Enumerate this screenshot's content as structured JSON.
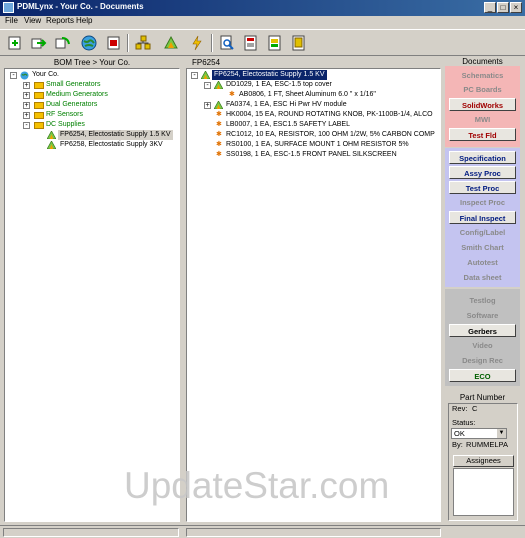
{
  "window": {
    "title": "PDMLynx - Your Co. - Documents",
    "controls": [
      "minimize",
      "maximize",
      "close"
    ]
  },
  "menu": [
    "File",
    "View",
    "Reports",
    "Help"
  ],
  "toolbar": {
    "icons": [
      "new-item-icon",
      "forward-icon",
      "refresh-icon",
      "globe-icon",
      "delete-icon",
      "bom-icon",
      "tree-icon",
      "lightning-icon",
      "search-icon",
      "report-icon",
      "export-icon",
      "print-icon"
    ]
  },
  "left_panel": {
    "header": "BOM Tree > Your Co.",
    "tree": [
      {
        "label": "Your Co.",
        "level": 0,
        "toggle": "-",
        "icon": "globe-icon"
      },
      {
        "label": "Small Generators",
        "level": 1,
        "toggle": "+",
        "icon": "folder-icon"
      },
      {
        "label": "Medium Generators",
        "level": 1,
        "toggle": "+",
        "icon": "folder-icon"
      },
      {
        "label": "Dual Generators",
        "level": 1,
        "toggle": "+",
        "icon": "folder-icon"
      },
      {
        "label": "RF Sensors",
        "level": 1,
        "toggle": "+",
        "icon": "folder-icon"
      },
      {
        "label": "DC Supplies",
        "level": 1,
        "toggle": "-",
        "icon": "folder-icon"
      },
      {
        "label": "FP6254, Electostatic Supply 1.5 KV",
        "level": 2,
        "toggle": "",
        "icon": "assembly-icon"
      },
      {
        "label": "FP6258, Electostatic Supply  3KV",
        "level": 2,
        "toggle": "",
        "icon": "assembly-icon"
      }
    ]
  },
  "center_panel": {
    "header": "FP6254",
    "tree": [
      {
        "label": "FP6254, Electostatic Supply 1.5 KV",
        "level": 0,
        "toggle": "-",
        "icon": "assembly-icon"
      },
      {
        "label": "DD1029, 1 EA, ESC-1.5 top cover",
        "level": 1,
        "toggle": "-",
        "icon": "assembly-icon"
      },
      {
        "label": "AB0806, 1 FT, Sheet Aluminum   6.0 \" x 1/16\"",
        "level": 2,
        "toggle": "",
        "icon": "part-icon"
      },
      {
        "label": "FA0374, 1 EA, ESC Hi Pwr HV module",
        "level": 1,
        "toggle": "+",
        "icon": "assembly-icon"
      },
      {
        "label": "HK0004, 15 EA, ROUND ROTATING KNOB, PK-1100B-1/4, ALCO",
        "level": 1,
        "toggle": "",
        "icon": "part-icon"
      },
      {
        "label": "LB0007, 1 EA, ESC1.5 SAFETY LABEL",
        "level": 1,
        "toggle": "",
        "icon": "part-icon"
      },
      {
        "label": "RC1012, 10 EA, RESISTOR, 100 OHM 1/2W, 5% CARBON COMP",
        "level": 1,
        "toggle": "",
        "icon": "part-icon"
      },
      {
        "label": "RS0100, 1 EA, SURFACE MOUNT 1 OHM RESISTOR 5%",
        "level": 1,
        "toggle": "",
        "icon": "part-icon"
      },
      {
        "label": "SS0198, 1 EA, ESC-1.5 FRONT PANEL SILKSCREEN",
        "level": 1,
        "toggle": "",
        "icon": "part-icon"
      }
    ]
  },
  "documents": {
    "header": "Documents",
    "buttons": [
      {
        "label": "Schematics",
        "state": "dim",
        "group": "red"
      },
      {
        "label": "PC Boards",
        "state": "dim",
        "group": "red"
      },
      {
        "label": "SolidWorks",
        "state": "boxed",
        "group": "red"
      },
      {
        "label": "MWI",
        "state": "dim",
        "group": "red"
      },
      {
        "label": "Test Fld",
        "state": "boxed",
        "group": "red"
      },
      {
        "label": "Specification",
        "state": "boxed",
        "group": "blue"
      },
      {
        "label": "Assy Proc",
        "state": "boxed",
        "group": "blue"
      },
      {
        "label": "Test Proc",
        "state": "boxed",
        "group": "blue"
      },
      {
        "label": "Inspect Proc",
        "state": "dim",
        "group": "blue"
      },
      {
        "label": "Final Inspect",
        "state": "boxed",
        "group": "blue"
      },
      {
        "label": "Config/Label",
        "state": "dim",
        "group": "blue"
      },
      {
        "label": "Smith Chart",
        "state": "dim",
        "group": "blue"
      },
      {
        "label": "Autotest",
        "state": "dim",
        "group": "blue"
      },
      {
        "label": "Data sheet",
        "state": "dim",
        "group": "blue"
      },
      {
        "label": "Testlog",
        "state": "dim",
        "group": "grey"
      },
      {
        "label": "Software",
        "state": "dim",
        "group": "grey"
      },
      {
        "label": "Gerbers",
        "state": "boxed",
        "group": "grey"
      },
      {
        "label": "Video",
        "state": "dim",
        "group": "grey"
      },
      {
        "label": "Design Rec",
        "state": "dim",
        "group": "grey"
      },
      {
        "label": "ECO",
        "state": "boxed",
        "group": "grey"
      }
    ],
    "colors": {
      "red_band": "#f4b6b6",
      "blue_band": "#c4c4f0",
      "grey_band": "#c0c0c0"
    }
  },
  "part_info": {
    "header": "Part Number",
    "rev_label": "Rev:",
    "rev_value": "C",
    "status_label": "Status:",
    "status_value": "OK",
    "by_label": "By:",
    "by_value": "RUMMELPA",
    "assignees_label": "Assignees"
  },
  "watermark": "UpdateStar.com"
}
